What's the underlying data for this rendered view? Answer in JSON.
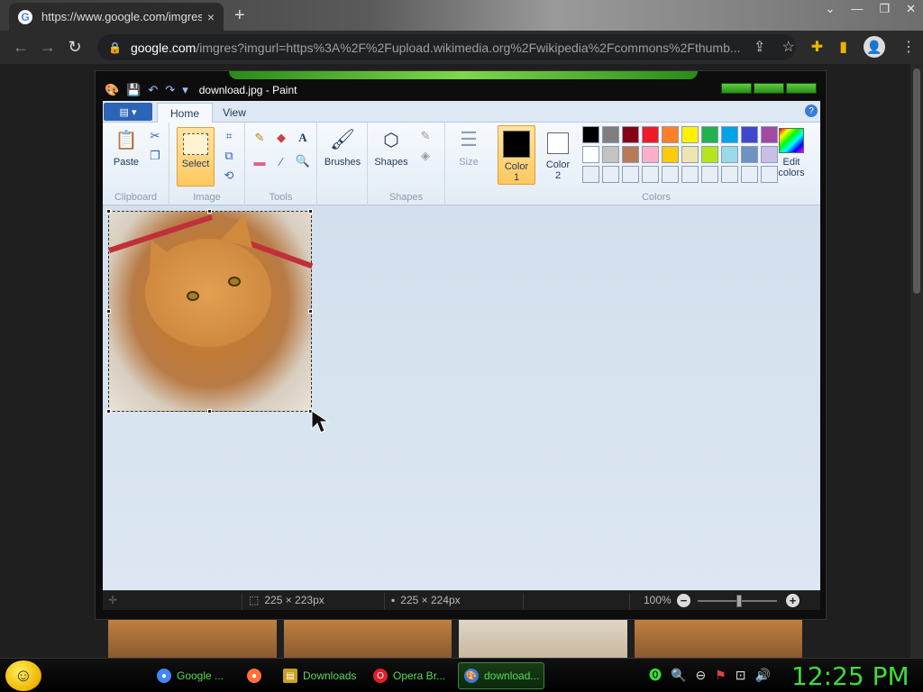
{
  "browser": {
    "tab_title": "https://www.google.com/imgres",
    "tab_close": "×",
    "new_tab": "+",
    "window_controls": [
      "⌄",
      "—",
      "❐",
      "✕"
    ],
    "back": "←",
    "forward": "→",
    "reload": "↻",
    "lock": "🔒",
    "url_domain": "google.com",
    "url_rest": "/imgres?imgurl=https%3A%2F%2Fupload.wikimedia.org%2Fwikipedia%2Fcommons%2Fthumb...",
    "share": "⇪",
    "star": "☆",
    "extension": "✚",
    "sidebar": "▮",
    "avatar": "👤",
    "menu": "⋮"
  },
  "paint": {
    "title": "download.jpg - Paint",
    "quick_access": [
      "🎨",
      "💾",
      "↶",
      "↷",
      "▾"
    ],
    "file_button": "▤ ▾",
    "tabs": {
      "home": "Home",
      "view": "View"
    },
    "help": "?",
    "groups": {
      "clipboard": {
        "label": "Clipboard",
        "paste": "Paste"
      },
      "image": {
        "label": "Image",
        "select": "Select"
      },
      "tools": {
        "label": "Tools"
      },
      "brushes": "Brushes",
      "shapes": {
        "label": "Shapes",
        "button": "Shapes"
      },
      "size": "Size",
      "colors": {
        "label": "Colors",
        "color1": "Color\n1",
        "color1_a": "Color",
        "color1_b": "1",
        "color2_a": "Color",
        "color2_b": "2",
        "edit_a": "Edit",
        "edit_b": "colors"
      }
    },
    "palette_row1": [
      "#000000",
      "#7f7f7f",
      "#880015",
      "#ed1c24",
      "#ff7f27",
      "#fff200",
      "#22b14c",
      "#00a2e8",
      "#3f48cc",
      "#a349a4"
    ],
    "palette_row2": [
      "#ffffff",
      "#c3c3c3",
      "#b97a57",
      "#ffaec9",
      "#ffc90e",
      "#efe4b0",
      "#b5e61d",
      "#99d9ea",
      "#7092be",
      "#c8bfe7"
    ],
    "status": {
      "selection_size": "225 × 223px",
      "image_size": "225 × 224px",
      "zoom": "100%",
      "zoom_out": "−",
      "zoom_in": "+"
    }
  },
  "taskbar": {
    "start": "☺",
    "items": [
      {
        "label": "Google ...",
        "icon_color": "#4285f4"
      },
      {
        "label": "",
        "icon_color": "#ff7139"
      },
      {
        "label": "Downloads",
        "icon_color": "#c8a020"
      },
      {
        "label": "Opera Br...",
        "icon_color": "#e0202a"
      },
      {
        "label": "download...",
        "icon_color": "#3a7bd5"
      }
    ],
    "tray": [
      "⓿",
      "🔍",
      "⊖",
      "⚑",
      "⊡",
      "🔊"
    ],
    "clock": "12:25 PM"
  }
}
